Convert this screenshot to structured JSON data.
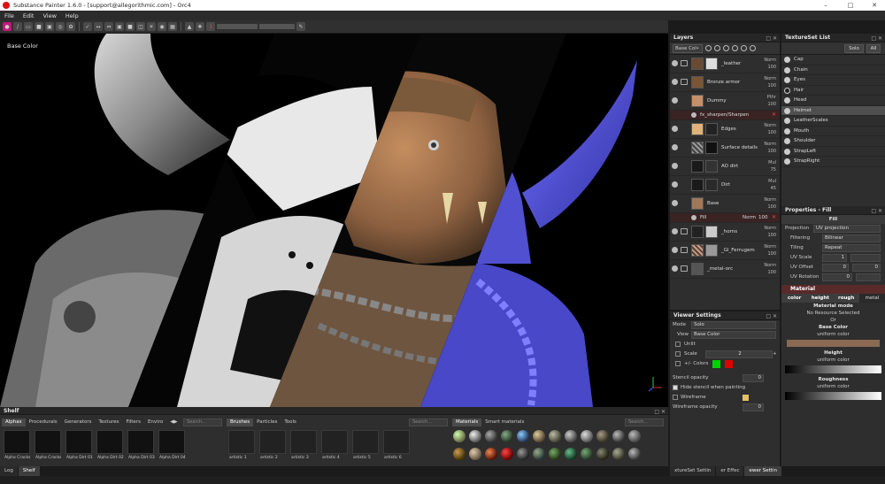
{
  "window": {
    "title": "Substance Painter 1.6.0 - [support@allegorithmic.com] - Orc4"
  },
  "menu": [
    "File",
    "Edit",
    "View",
    "Help"
  ],
  "viewport": {
    "label": "Base Color"
  },
  "layers": {
    "title": "Layers",
    "channel": "Base Col•",
    "items": [
      {
        "name": "_leather",
        "mode": "Norm",
        "opacity": "100",
        "type": "folder"
      },
      {
        "name": "Bronze armor",
        "mode": "Norm",
        "opacity": "100",
        "type": "folder"
      },
      {
        "name": "Dummy",
        "mode": "Pthr",
        "opacity": "100",
        "type": "layer"
      },
      {
        "name": "fx_sharpen/Sharpen",
        "mode": "",
        "opacity": "",
        "type": "effect"
      },
      {
        "name": "Edges",
        "mode": "Norm",
        "opacity": "100",
        "type": "layer"
      },
      {
        "name": "Surface details",
        "mode": "Norm",
        "opacity": "100",
        "type": "layer"
      },
      {
        "name": "AO dirt",
        "mode": "Mul",
        "opacity": "75",
        "type": "layer"
      },
      {
        "name": "Dirt",
        "mode": "Mul",
        "opacity": "45",
        "type": "layer"
      },
      {
        "name": "Base",
        "mode": "Norm",
        "opacity": "100",
        "type": "layer"
      },
      {
        "name": "Fill",
        "mode": "Norm",
        "opacity": "100",
        "type": "fill"
      },
      {
        "name": "_horns",
        "mode": "Norm",
        "opacity": "100",
        "type": "folder"
      },
      {
        "name": "_Gl_Ferrugem",
        "mode": "Norm",
        "opacity": "100",
        "type": "folder"
      },
      {
        "name": "_metal-orc",
        "mode": "Norm",
        "opacity": "100",
        "type": "folder"
      }
    ]
  },
  "textureset": {
    "title": "TextureSet List",
    "solo": "Solo",
    "all": "All",
    "items": [
      {
        "name": "Cap",
        "visible": true,
        "active": false
      },
      {
        "name": "Chain",
        "visible": true,
        "active": false
      },
      {
        "name": "Eyes",
        "visible": true,
        "active": false
      },
      {
        "name": "Hair",
        "visible": false,
        "active": false
      },
      {
        "name": "Head",
        "visible": true,
        "active": false
      },
      {
        "name": "Helmet",
        "visible": true,
        "active": true
      },
      {
        "name": "LeatherScales",
        "visible": true,
        "active": false
      },
      {
        "name": "Mouth",
        "visible": true,
        "active": false
      },
      {
        "name": "Shoulder",
        "visible": true,
        "active": false
      },
      {
        "name": "StrapLeft",
        "visible": true,
        "active": false
      },
      {
        "name": "StrapRight",
        "visible": true,
        "active": false
      }
    ]
  },
  "properties": {
    "title": "Properties - Fill",
    "section": "Fill",
    "projection_label": "Projection",
    "projection_value": "UV projection",
    "filtering_label": "Filtering",
    "filtering_value": "Bilinear",
    "tiling_label": "Tiling",
    "tiling_value": "Repeat",
    "uvscale_label": "UV Scale",
    "uvscale_value": "1",
    "uvoffset_label": "UV Offset",
    "uvoffset_x": "0",
    "uvoffset_y": "0",
    "uvrot_label": "UV Rotation",
    "uvrot_value": "0",
    "material_section": "Material",
    "mat_tabs": [
      "color",
      "height",
      "rough",
      "metal"
    ],
    "material_mode": "Material mode",
    "no_resource": "No Resource Selected",
    "or": "Or",
    "base_color": "Base Color",
    "uniform1": "uniform color",
    "height": "Height",
    "uniform2": "uniform color",
    "roughness": "Roughness",
    "uniform3": "uniform color"
  },
  "viewer": {
    "title": "Viewer Settings",
    "mode_label": "Mode",
    "mode_value": "Solo",
    "view_label": "View",
    "view_value": "Base Color",
    "unlit": "Unlit",
    "scale": "Scale",
    "scale_value": "2",
    "colors": "+/- Colors",
    "stencil_label": "Stencil opacity",
    "stencil_value": "0",
    "hide_stencil": "Hide stencil when painting",
    "wireframe": "Wireframe",
    "wire_op_label": "Wireframe opacity",
    "wire_op_value": "0",
    "colors_pos": "#00d000",
    "colors_neg": "#e00000",
    "tabs": [
      "xtureSet Settin",
      "er Effec",
      "ewer Settin"
    ]
  },
  "shelf": {
    "title": "Shelf",
    "tabs": [
      "Alphas",
      "Procedurals",
      "Generators",
      "Textures",
      "Filters",
      "Enviro"
    ],
    "search": "Search...",
    "alphas": [
      "Alpha Cracks",
      "Alpha Cracks",
      "Alpha Dirt 01",
      "Alpha Dirt 02",
      "Alpha Dirt 03",
      "Alpha Dirt 04"
    ],
    "tabs2": [
      "Brushes",
      "Particles",
      "Tools"
    ],
    "search2": "Search...",
    "brushes": [
      "artistic 1",
      "artistic 2",
      "artistic 3",
      "artistic 4",
      "artistic 5",
      "artistic 6"
    ],
    "tabs3": [
      "Materials",
      "Smart materials"
    ],
    "search3": "Search..."
  },
  "bottom": {
    "log": "Log",
    "shelf": "Shelf"
  }
}
